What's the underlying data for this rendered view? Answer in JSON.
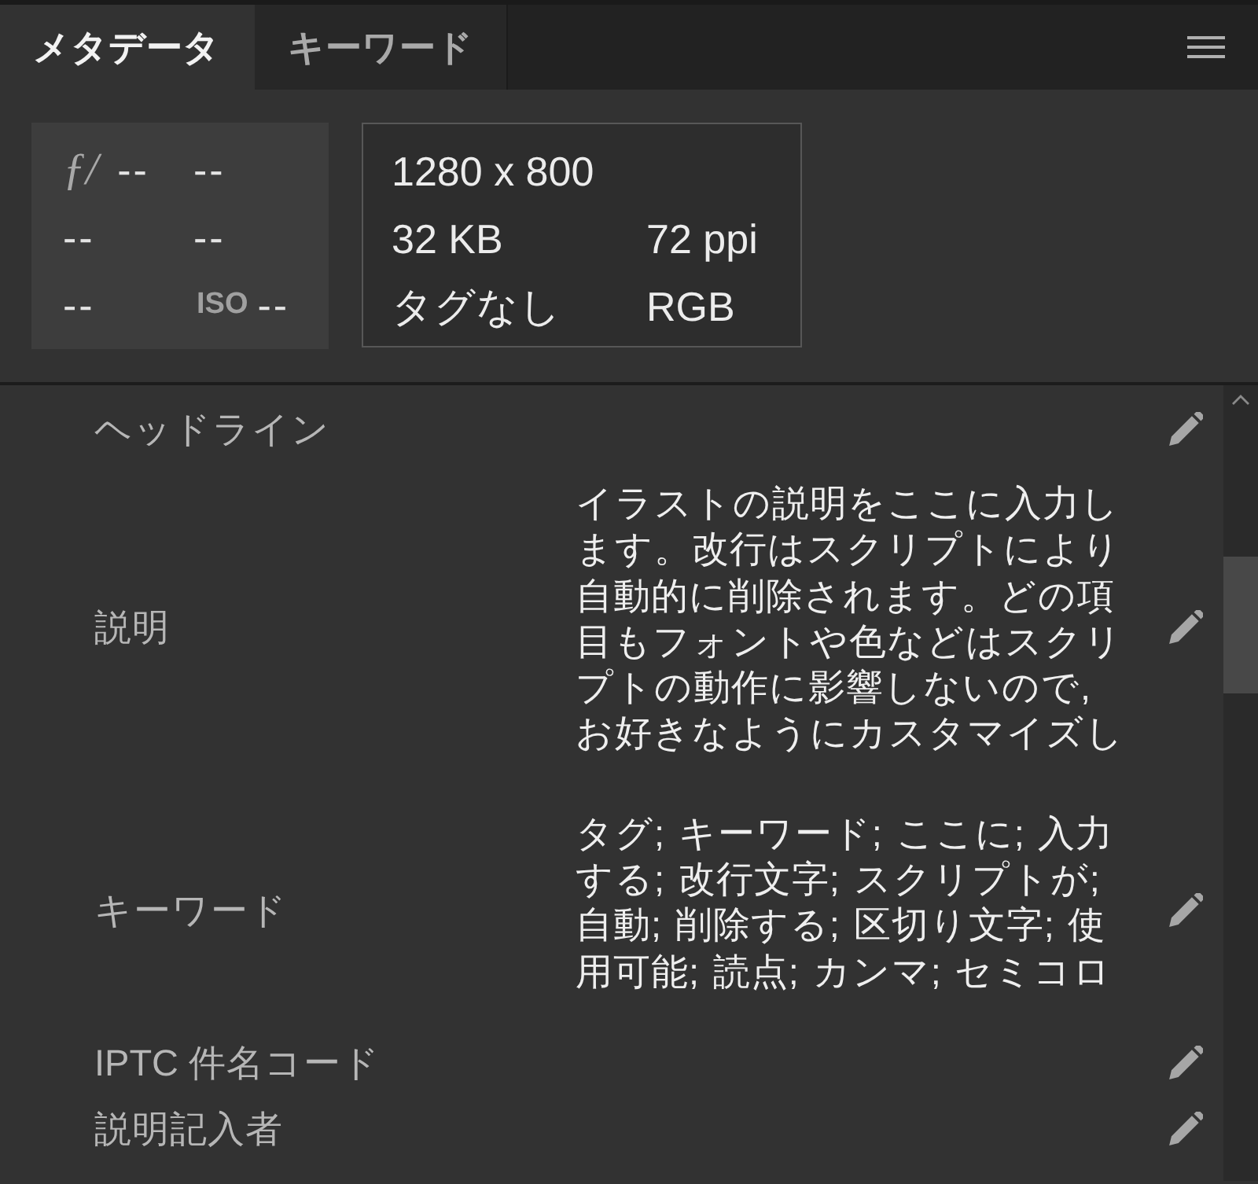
{
  "tabs": [
    {
      "label": "メタデータ",
      "selected": true
    },
    {
      "label": "キーワード",
      "selected": false
    }
  ],
  "exposure": {
    "cells": [
      {
        "kind": "aperture",
        "prefix": "ƒ/",
        "value": "--"
      },
      {
        "kind": "value",
        "value": "--"
      },
      {
        "kind": "value",
        "value": "--"
      },
      {
        "kind": "value",
        "value": "--"
      },
      {
        "kind": "value",
        "value": "--"
      },
      {
        "kind": "iso",
        "prefix": "ISO",
        "value": "--"
      }
    ]
  },
  "file_info": {
    "dimensions": "1280 x 800",
    "file_size": "32 KB",
    "resolution": "72 ppi",
    "color_profile": "タグなし",
    "color_mode": "RGB"
  },
  "fields": [
    {
      "label": "ヘッドライン"
    },
    {
      "label": "説明",
      "value": "イラストの説明をここに入力します。改行はスクリプトにより自動的に削除されます。どの項目もフォントや色などはスクリプトの動作に影響しないので, お好きなようにカスタマイズし"
    },
    {
      "label": "キーワード",
      "value": "タグ; キーワード; ここに; 入力する; 改行文字; スクリプトが; 自動; 削除する; 区切り文字; 使用可能; 読点; カンマ; セミコロ"
    },
    {
      "label": "IPTC 件名コード"
    },
    {
      "label": "説明記入者"
    }
  ]
}
